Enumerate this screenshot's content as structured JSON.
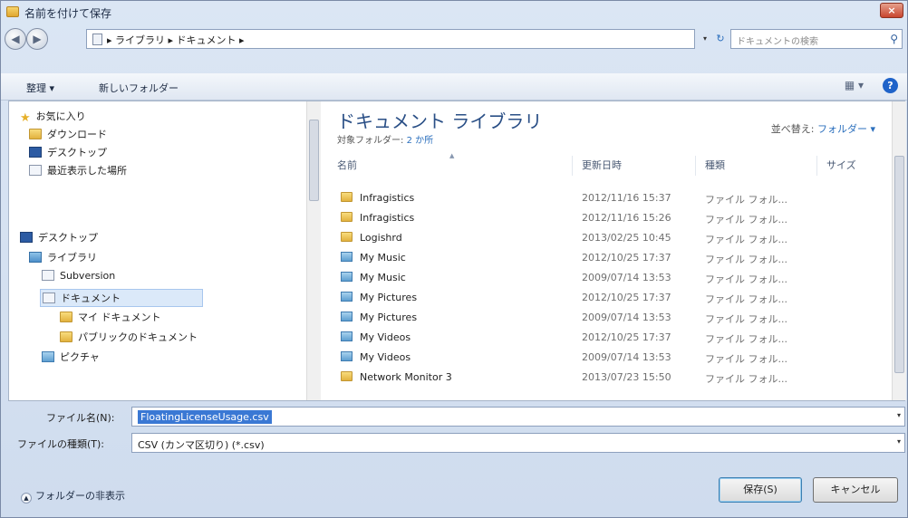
{
  "window": {
    "title": "名前を付けて保存",
    "close": "×"
  },
  "address": {
    "path": "▸ ライブラリ ▸ ドキュメント ▸",
    "search_placeholder": "ドキュメントの検索",
    "back": "◀",
    "forward": "▶",
    "dropdown": "▾",
    "refresh": "↻",
    "search_icon": "⚲"
  },
  "toolbar": {
    "organize": "整理 ▾",
    "new_folder": "新しいフォルダー",
    "views": "▦ ▾",
    "help": "?"
  },
  "nav": {
    "items": [
      {
        "label": "お気に入り",
        "icon": "star-icon"
      },
      {
        "label": "ダウンロード",
        "icon": "folder-icon"
      },
      {
        "label": "デスクトップ",
        "icon": "desktop-icon"
      },
      {
        "label": "最近表示した場所",
        "icon": "recent-icon"
      },
      {
        "label": "デスクトップ",
        "icon": "desktop-icon"
      },
      {
        "label": "ライブラリ",
        "icon": "library-icon"
      },
      {
        "label": "Subversion",
        "icon": "document-icon"
      },
      {
        "label": "ドキュメント",
        "icon": "document-icon"
      },
      {
        "label": "マイ ドキュメント",
        "icon": "folder-icon"
      },
      {
        "label": "パブリックのドキュメント",
        "icon": "folder-icon"
      },
      {
        "label": "ピクチャ",
        "icon": "picture-icon"
      }
    ]
  },
  "library": {
    "title": "ドキュメント ライブラリ",
    "subtitle_prefix": "対象フォルダー: ",
    "subtitle_count": "2 か所",
    "arrange_label": "並べ替え: ",
    "arrange_value": "フォルダー ▾"
  },
  "columns": {
    "name": "名前",
    "date": "更新日時",
    "type": "種類",
    "size": "サイズ"
  },
  "files": [
    {
      "name": "Infragistics",
      "date": "2012/11/16 15:37",
      "type": "ファイル フォル...",
      "icon": "folder-icon"
    },
    {
      "name": "Infragistics",
      "date": "2012/11/16 15:26",
      "type": "ファイル フォル...",
      "icon": "folder-icon"
    },
    {
      "name": "Logishrd",
      "date": "2013/02/25 10:45",
      "type": "ファイル フォル...",
      "icon": "folder-icon"
    },
    {
      "name": "My Music",
      "date": "2012/10/25 17:37",
      "type": "ファイル フォル...",
      "icon": "music-folder-icon"
    },
    {
      "name": "My Music",
      "date": "2009/07/14 13:53",
      "type": "ファイル フォル...",
      "icon": "music-folder-icon"
    },
    {
      "name": "My Pictures",
      "date": "2012/10/25 17:37",
      "type": "ファイル フォル...",
      "icon": "pictures-folder-icon"
    },
    {
      "name": "My Pictures",
      "date": "2009/07/14 13:53",
      "type": "ファイル フォル...",
      "icon": "pictures-folder-icon"
    },
    {
      "name": "My Videos",
      "date": "2012/10/25 17:37",
      "type": "ファイル フォル...",
      "icon": "videos-folder-icon"
    },
    {
      "name": "My Videos",
      "date": "2009/07/14 13:53",
      "type": "ファイル フォル...",
      "icon": "videos-folder-icon"
    },
    {
      "name": "Network Monitor 3",
      "date": "2013/07/23 15:50",
      "type": "ファイル フォル...",
      "icon": "folder-icon"
    }
  ],
  "form": {
    "filename_label": "ファイル名(N):",
    "filename_value": "FloatingLicenseUsage.csv",
    "filetype_label": "ファイルの種類(T):",
    "filetype_value": "CSV (カンマ区切り) (*.csv)",
    "dropdown": "▾"
  },
  "footer": {
    "hide_folders": "フォルダーの非表示",
    "save": "保存(S)",
    "cancel": "キャンセル",
    "chevron": "▲"
  }
}
